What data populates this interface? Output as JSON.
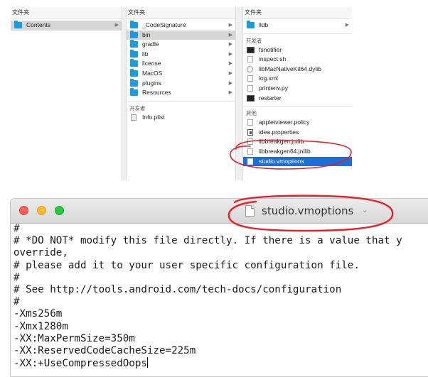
{
  "finder": {
    "columns": [
      {
        "header": "文件夹",
        "items": [
          {
            "label": "Contents",
            "icon": "folder-icon",
            "selected": true,
            "chevron": true
          }
        ]
      },
      {
        "header": "文件夹",
        "items": [
          {
            "label": "_CodeSignature",
            "icon": "folder-icon",
            "chevron": true
          },
          {
            "label": "bin",
            "icon": "folder-icon",
            "chevron": true,
            "selected": true
          },
          {
            "label": "gradle",
            "icon": "folder-icon",
            "chevron": true
          },
          {
            "label": "lib",
            "icon": "folder-icon",
            "chevron": true
          },
          {
            "label": "license",
            "icon": "folder-icon",
            "chevron": true
          },
          {
            "label": "MacOS",
            "icon": "folder-icon",
            "chevron": true
          },
          {
            "label": "plugins",
            "icon": "folder-icon",
            "chevron": true
          },
          {
            "label": "Resources",
            "icon": "folder-icon",
            "chevron": true
          }
        ],
        "developer_header": "开发者",
        "developer_items": [
          {
            "label": "Info.plist",
            "icon": "plist-file-icon"
          }
        ]
      },
      {
        "header": "文件夹",
        "items": [
          {
            "label": "lldb",
            "icon": "folder-icon",
            "chevron": true
          }
        ],
        "developer_header": "开发者",
        "developer_items": [
          {
            "label": "fsnotifier",
            "icon": "executable-icon"
          },
          {
            "label": "inspect.sh",
            "icon": "document-icon"
          },
          {
            "label": "libMacNativeKit64.dylib",
            "icon": "dylib-icon"
          },
          {
            "label": "log.xml",
            "icon": "document-icon"
          },
          {
            "label": "printenv.py",
            "icon": "document-icon"
          },
          {
            "label": "restarter",
            "icon": "executable-icon"
          }
        ],
        "other_header": "其他",
        "other_items": [
          {
            "label": "appletviewer.policy",
            "icon": "document-icon"
          },
          {
            "label": "idea.properties",
            "icon": "properties-file-icon"
          },
          {
            "label": "libbreakgen.jnilib",
            "icon": "document-icon"
          },
          {
            "label": "libbreakgen64.jnilib",
            "icon": "document-icon"
          },
          {
            "label": "studio.vmoptions",
            "icon": "document-icon",
            "selected": true
          }
        ]
      }
    ]
  },
  "editor": {
    "title": "studio.vmoptions",
    "title_chevron": "⌄",
    "lines": [
      "#",
      "# *DO NOT* modify this file directly. If there is a value that y",
      "override,",
      "# please add it to your user specific configuration file.",
      "#",
      "# See http://tools.android.com/tech-docs/configuration",
      "#",
      "-Xms256m",
      "-Xmx1280m",
      "-XX:MaxPermSize=350m",
      "-XX:ReservedCodeCacheSize=225m",
      "-XX:+UseCompressedOops"
    ]
  },
  "colors": {
    "selection_blue": "#1e6ed8",
    "folder_blue": "#1a9de0",
    "annotation_red": "#e8202a",
    "close": "#fd5f57",
    "minimize": "#fdbc2e",
    "zoom": "#28c840"
  }
}
